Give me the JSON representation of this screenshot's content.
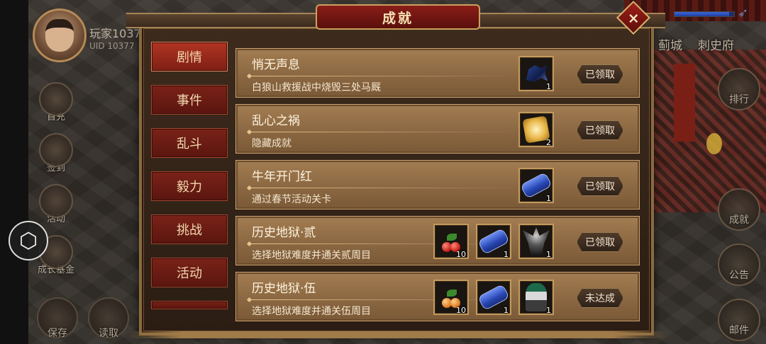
{
  "hud": {
    "player_name": "玩家1037",
    "player_uid": "UID 10377",
    "place_labels": [
      "蓟城",
      "刺史府"
    ],
    "hp_fraction": 0.92,
    "left_buttons": [
      "首充",
      "签到",
      "活动",
      "成长基金"
    ],
    "bottom_buttons": [
      "保存",
      "读取"
    ],
    "right_buttons": [
      "排行",
      "成就",
      "公告",
      "邮件"
    ]
  },
  "dialog": {
    "title": "成就",
    "close_label": "×",
    "tabs": [
      {
        "label": "剧情",
        "active": true
      },
      {
        "label": "事件",
        "active": false
      },
      {
        "label": "乱斗",
        "active": false
      },
      {
        "label": "毅力",
        "active": false
      },
      {
        "label": "挑战",
        "active": false
      },
      {
        "label": "活动",
        "active": false
      }
    ],
    "achievements": [
      {
        "title": "悄无声息",
        "desc": "白狼山救援战中烧毁三处马厩",
        "rewards": [
          {
            "icon": "horse-icon",
            "qty": "1"
          }
        ],
        "status": "已领取"
      },
      {
        "title": "乱心之祸",
        "desc": "隐藏成就",
        "rewards": [
          {
            "icon": "gold-coin-icon",
            "qty": "2"
          }
        ],
        "status": "已领取"
      },
      {
        "title": "牛年开门红",
        "desc": "通过春节活动关卡",
        "rewards": [
          {
            "icon": "blue-scroll-icon",
            "qty": "1"
          }
        ],
        "status": "已领取"
      },
      {
        "title": "历史地狱·贰",
        "desc": "选择地狱难度并通关贰周目",
        "rewards": [
          {
            "icon": "red-fruit-icon",
            "qty": "10"
          },
          {
            "icon": "blue-scroll-icon",
            "qty": "1"
          },
          {
            "icon": "demon-general-icon",
            "qty": "1"
          }
        ],
        "status": "已领取"
      },
      {
        "title": "历史地狱·伍",
        "desc": "选择地狱难度并通关伍周目",
        "rewards": [
          {
            "icon": "orange-fruit-icon",
            "qty": "10"
          },
          {
            "icon": "blue-scroll-icon",
            "qty": "1"
          },
          {
            "icon": "warrior-general-icon",
            "qty": "1"
          }
        ],
        "status": "未达成"
      }
    ]
  },
  "colors": {
    "tab_active": "#b23422",
    "tab_inactive": "#7a2218",
    "row_bg": "#8b6842",
    "title_plate": "#8a1d18",
    "frame_gold": "#8b6a40"
  }
}
